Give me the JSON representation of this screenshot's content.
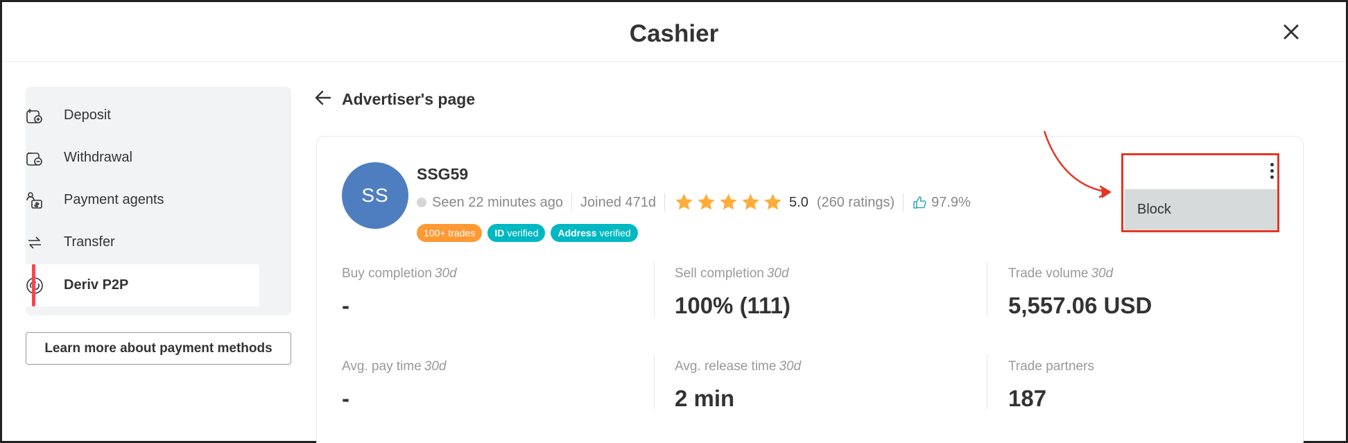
{
  "header": {
    "title": "Cashier"
  },
  "sidebar": {
    "items": [
      {
        "label": "Deposit",
        "icon": "deposit-icon"
      },
      {
        "label": "Withdrawal",
        "icon": "withdrawal-icon"
      },
      {
        "label": "Payment agents",
        "icon": "payment-agents-icon"
      },
      {
        "label": "Transfer",
        "icon": "transfer-icon"
      },
      {
        "label": "Deriv P2P",
        "icon": "deriv-p2p-icon",
        "active": true
      }
    ],
    "learn_more": "Learn more about payment methods"
  },
  "page": {
    "back_label": "Advertiser's page"
  },
  "advertiser": {
    "initials": "SS",
    "nickname": "SSG59",
    "seen": "Seen 22 minutes ago",
    "joined": "Joined 471d",
    "rating_stars": 5,
    "rating": "5.0",
    "ratings_count": "(260 ratings)",
    "recommended": "97.9%",
    "badges": {
      "trades": "100+ trades",
      "id_strong": "ID",
      "id_rest": "verified",
      "address_strong": "Address",
      "address_rest": "verified"
    }
  },
  "stats": [
    {
      "label": "Buy completion",
      "period": "30d",
      "value": "-"
    },
    {
      "label": "Sell completion",
      "period": "30d",
      "value": "100% (111)"
    },
    {
      "label": "Trade volume",
      "period": "30d",
      "value": "5,557.06 USD"
    },
    {
      "label": "Avg. pay time",
      "period": "30d",
      "value": "-"
    },
    {
      "label": "Avg. release time",
      "period": "30d",
      "value": "2 min"
    },
    {
      "label": "Trade partners",
      "period": "",
      "value": "187"
    }
  ],
  "menu": {
    "items": [
      "Block"
    ]
  },
  "colors": {
    "accent": "#ff444f",
    "avatar": "#4f7ec0",
    "star": "#ffad3a",
    "badge_orange": "#ff9933",
    "badge_teal": "#00b8c2",
    "annotation": "#e53725"
  }
}
